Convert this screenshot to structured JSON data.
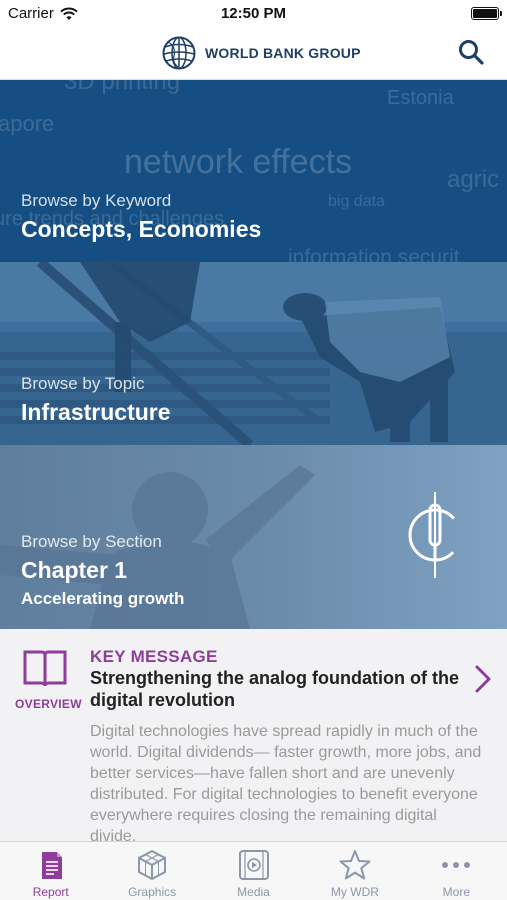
{
  "status_bar": {
    "carrier": "Carrier",
    "time": "12:50 PM"
  },
  "header": {
    "logo_text": "WORLD BANK GROUP",
    "search_icon": "search-icon"
  },
  "keyword_panel": {
    "cloud_words": [
      "3D printing",
      "Estonia",
      "apore",
      "network effects",
      "agric",
      "big data",
      "ure trends and challenges",
      "information securit"
    ],
    "kicker": "Browse by Keyword",
    "title": "Concepts, Economies"
  },
  "topic_panel": {
    "kicker": "Browse by Topic",
    "title": "Infrastructure"
  },
  "section_panel": {
    "kicker": "Browse by Section",
    "title": "Chapter 1",
    "subtitle": "Accelerating growth",
    "icon": "power-icon"
  },
  "key_message": {
    "overview_label": "OVERVIEW",
    "label": "KEY MESSAGE",
    "title": "Strengthening the analog foundation of the digital revolution",
    "body": "Digital technologies have spread rapidly in much of the world. Digital dividends— faster growth, more jobs, and better services—have fallen short and are unevenly distributed. For digital technologies to benefit everyone everywhere requires closing the remaining digital divide."
  },
  "tabs": [
    {
      "label": "Report",
      "icon": "report-icon",
      "active": true
    },
    {
      "label": "Graphics",
      "icon": "cube-icon",
      "active": false
    },
    {
      "label": "Media",
      "icon": "media-icon",
      "active": false
    },
    {
      "label": "My WDR",
      "icon": "star-icon",
      "active": false
    },
    {
      "label": "More",
      "icon": "more-icon",
      "active": false
    }
  ],
  "colors": {
    "accent": "#8e3e9a",
    "brand_blue": "#1e3f66",
    "keyword_panel": "#154e83",
    "topic_panel": "#3c6f9c",
    "section_panel": "#6c8cac"
  }
}
